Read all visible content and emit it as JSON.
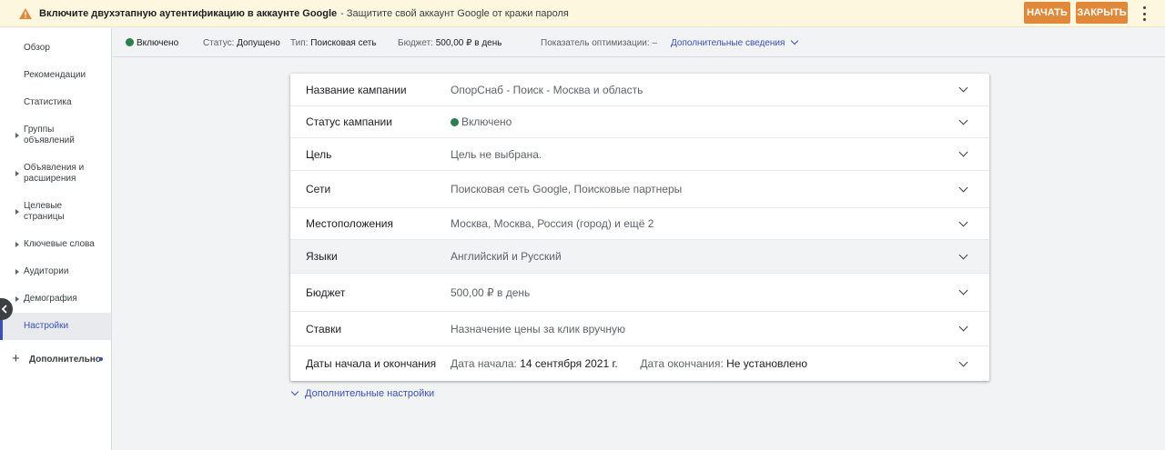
{
  "notification": {
    "title": "Включите двухэтапную аутентификацию в аккаунте Google",
    "message": "- Защитите свой аккаунт Google от кражи пароля",
    "start_label": "НАЧАТЬ",
    "close_label": "ЗАКРЫТЬ",
    "icon": "warning-icon",
    "accent": "#e0893a"
  },
  "sidebar": {
    "items": [
      {
        "label": "Обзор"
      },
      {
        "label": "Рекомендации"
      },
      {
        "label": "Статистика"
      },
      {
        "label": "Группы объявлений"
      },
      {
        "label": "Объявления и расширения"
      },
      {
        "label": "Целевые страницы"
      },
      {
        "label": "Ключевые слова"
      },
      {
        "label": "Аудитории"
      },
      {
        "label": "Демография"
      },
      {
        "label": "Настройки"
      }
    ],
    "more_label": "Дополнительно"
  },
  "status_bar": {
    "enabled": "Включено",
    "status_key": "Статус:",
    "status_value": "Допущено",
    "type_key": "Тип:",
    "type_value": "Поисковая сеть",
    "budget_key": "Бюджет:",
    "budget_value": "500,00 ₽ в день",
    "optimization": "Показатель оптимизации: –",
    "details_link": "Дополнительные сведения"
  },
  "settings": {
    "rows": [
      {
        "label": "Название кампании",
        "value": "ОпорСнаб - Поиск - Москва и область"
      },
      {
        "label": "Статус кампании",
        "value": "Включено"
      },
      {
        "label": "Цель",
        "value": "Цель не выбрана."
      },
      {
        "label": "Сети",
        "value": "Поисковая сеть Google, Поисковые партнеры"
      },
      {
        "label": "Местоположения",
        "value": "Москва, Москва, Россия (город) и ещё 2"
      },
      {
        "label": "Языки",
        "value": "Английский и Русский"
      },
      {
        "label": "Бюджет",
        "value": "500,00 ₽ в день"
      },
      {
        "label": "Ставки",
        "value": "Назначение цены за клик вручную"
      },
      {
        "label": "Даты начала и окончания",
        "start_key": "Дата начала:",
        "start_value": "14 сентября 2021 г.",
        "end_key": "Дата окончания:",
        "end_value": "Не установлено"
      }
    ],
    "advanced_link": "Дополнительные настройки"
  },
  "colors": {
    "link": "#3c4fb5",
    "status_green": "#2e7d4f",
    "warning_bg": "#fef7e0"
  }
}
